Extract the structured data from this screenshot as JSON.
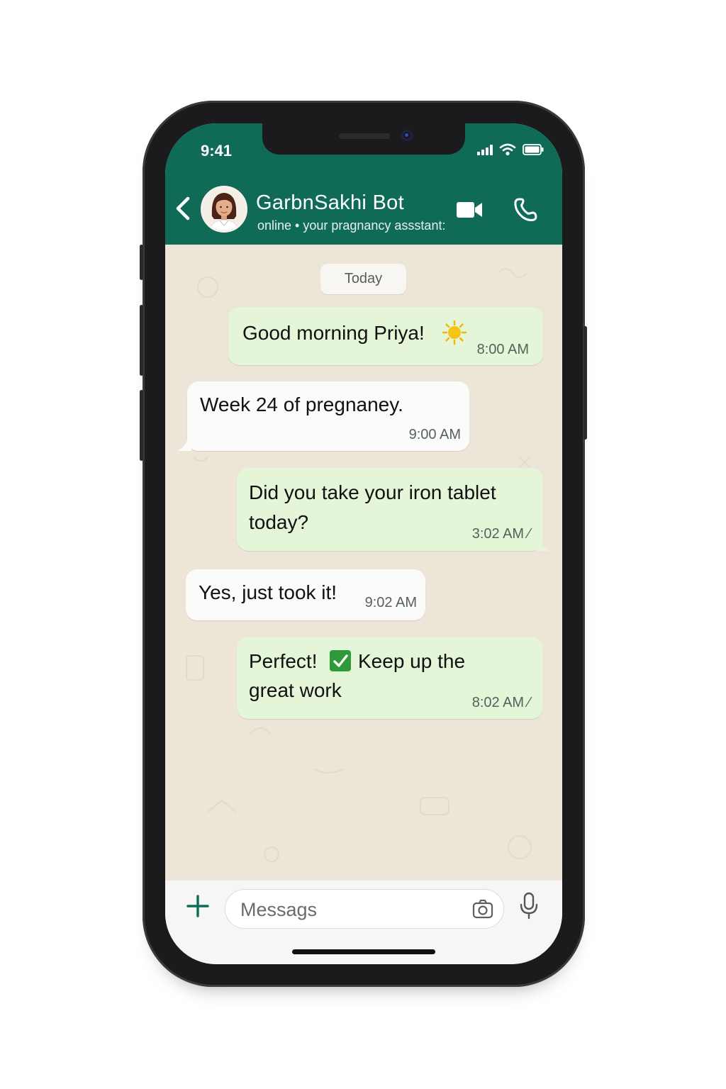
{
  "status_bar": {
    "time": "9:41"
  },
  "header": {
    "contact_name": "GarbnSakhi Bot",
    "contact_status": "online • your pragnancy assstant:",
    "accent_color": "#0f6b55",
    "icons": [
      "back-arrow-icon",
      "avatar",
      "video-call-icon",
      "phone-call-icon"
    ]
  },
  "chat": {
    "date_label": "Today",
    "messages": [
      {
        "direction": "outgoing",
        "text": "Good morning Priya!",
        "emoji": "sun-emoji",
        "time": "8:00 AM"
      },
      {
        "direction": "incoming",
        "text": "Week 24 of pregnaney.",
        "time": "9:00 AM"
      },
      {
        "direction": "outgoing",
        "text_line1": "Did you take your iron tablet",
        "text_line2": "today?",
        "time": "3:02 AM",
        "tick": "⁄"
      },
      {
        "direction": "incoming",
        "text": "Yes, just took it!",
        "time": "9:02 AM"
      },
      {
        "direction": "outgoing",
        "text_part1": "Perfect!",
        "emoji": "check-emoji",
        "text_part2": "Keep up the",
        "text_line2": "great work",
        "time": "8:02 AM",
        "tick": "⁄"
      }
    ]
  },
  "composer": {
    "placeholder": "Messags",
    "icons": [
      "plus-icon",
      "camera-icon",
      "microphone-icon"
    ]
  }
}
